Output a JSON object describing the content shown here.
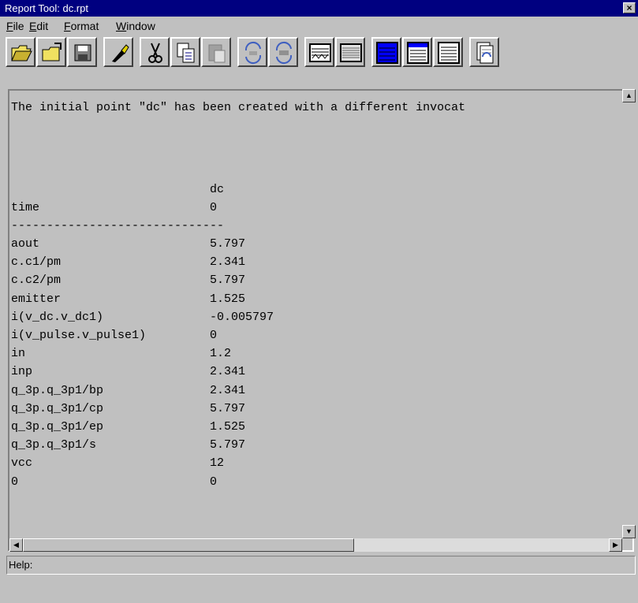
{
  "window": {
    "title": "Report Tool: dc.rpt",
    "close_glyph": "×"
  },
  "menu": [
    {
      "key": "F",
      "rest": "ile"
    },
    {
      "key": "E",
      "rest": "dit"
    },
    {
      "key": "F",
      "rest": "ormat"
    },
    {
      "key": "W",
      "rest": "indow"
    }
  ],
  "toolbar": {
    "buttons": [
      "open-folder-icon",
      "open-file-icon",
      "save-icon",
      "highlight-icon",
      "cut-icon",
      "copy-icon",
      "paste-icon",
      "refresh-icon",
      "refresh-alt-icon",
      "waveform-icon",
      "waveform-alt-icon",
      "align-left-icon",
      "align-center-icon",
      "align-right-icon",
      "report-icon"
    ]
  },
  "report": {
    "message": "The initial point \"dc\" has been created with a different invocat",
    "header": {
      "name": "",
      "value": "dc"
    },
    "time_row": {
      "name": "time",
      "value": "0"
    },
    "separator": "------------------------------",
    "rows": [
      {
        "name": "aout",
        "value": "5.797"
      },
      {
        "name": "c.c1/pm",
        "value": "2.341"
      },
      {
        "name": "c.c2/pm",
        "value": "5.797"
      },
      {
        "name": "emitter",
        "value": "1.525"
      },
      {
        "name": "i(v_dc.v_dc1)",
        "value": "-0.005797"
      },
      {
        "name": "i(v_pulse.v_pulse1)",
        "value": "0"
      },
      {
        "name": "in",
        "value": "1.2"
      },
      {
        "name": "inp",
        "value": "2.341"
      },
      {
        "name": "q_3p.q_3p1/bp",
        "value": "2.341"
      },
      {
        "name": "q_3p.q_3p1/cp",
        "value": "5.797"
      },
      {
        "name": "q_3p.q_3p1/ep",
        "value": "1.525"
      },
      {
        "name": "q_3p.q_3p1/s",
        "value": "5.797"
      },
      {
        "name": "vcc",
        "value": "12"
      },
      {
        "name": "0",
        "value": "0"
      }
    ]
  },
  "status": {
    "help": "Help:"
  }
}
